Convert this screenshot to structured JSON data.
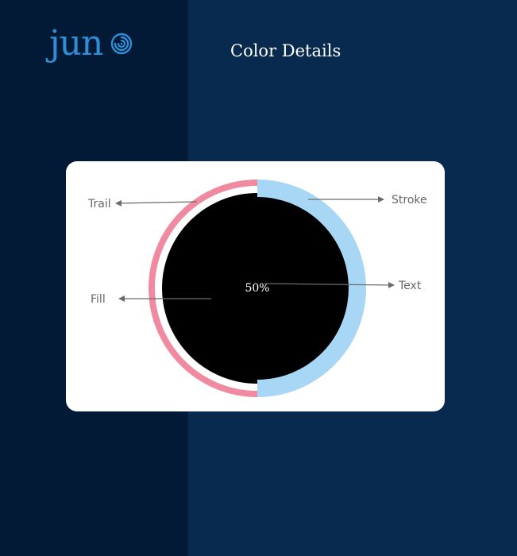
{
  "brand": {
    "name": "jun",
    "logo_mark": "spiral-icon",
    "color": "#2f8ed6"
  },
  "header": {
    "title": "Color Details"
  },
  "diagram": {
    "progress_value": "50%",
    "progress_fraction": 0.5,
    "labels": {
      "trail": "Trail",
      "stroke": "Stroke",
      "fill": "Fill",
      "text": "Text"
    },
    "colors": {
      "trail": "#f08aa0",
      "stroke": "#a7d7f5",
      "fill": "#000000",
      "text": "#ffffff",
      "arrow": "#6b6b6b",
      "card": "#ffffff"
    }
  },
  "colors": {
    "page_bg": "#082a4f",
    "left_panel_bg": "#031a36",
    "title": "#ffffff"
  }
}
